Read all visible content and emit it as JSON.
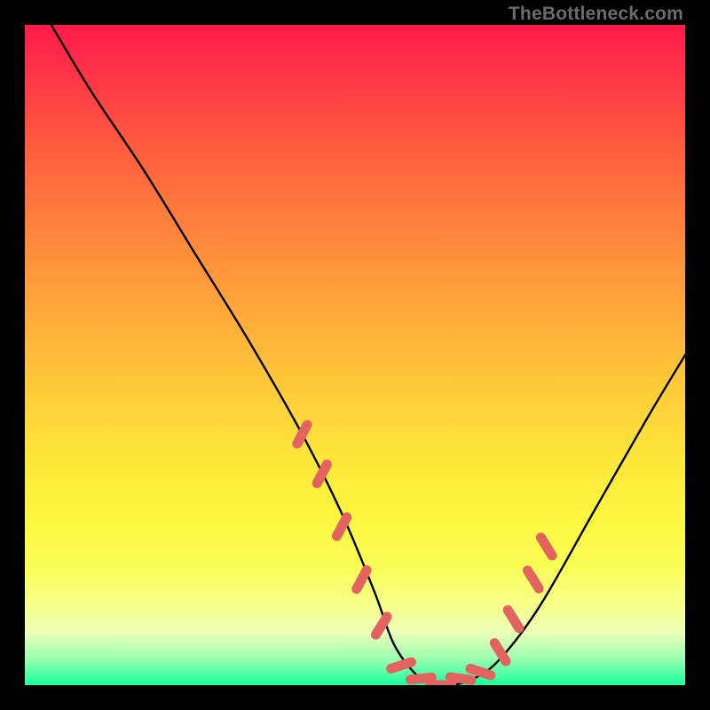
{
  "watermark": "TheBottleneck.com",
  "chart_data": {
    "type": "line",
    "title": "",
    "xlabel": "",
    "ylabel": "",
    "xlim": [
      0,
      100
    ],
    "ylim": [
      0,
      100
    ],
    "background_gradient": {
      "direction": "vertical",
      "stops": [
        {
          "pos": 0,
          "color": "#ff1a4a"
        },
        {
          "pos": 50,
          "color": "#ffd339"
        },
        {
          "pos": 82,
          "color": "#faff55"
        },
        {
          "pos": 100,
          "color": "#19ff9e"
        }
      ]
    },
    "series": [
      {
        "name": "bottleneck-curve",
        "color": "#000000",
        "x": [
          4,
          10,
          18,
          26,
          34,
          42,
          48,
          53,
          56,
          60,
          64,
          68,
          72,
          78,
          86,
          94,
          100
        ],
        "values": [
          100,
          90,
          78,
          65,
          52,
          38,
          26,
          14,
          6,
          1,
          0,
          1,
          4,
          12,
          26,
          40,
          50
        ]
      }
    ],
    "markers": {
      "name": "highlight-dashes",
      "color": "#e2635f",
      "segments": [
        {
          "x": 42,
          "y": 38,
          "angle": -62
        },
        {
          "x": 45,
          "y": 32,
          "angle": -62
        },
        {
          "x": 48,
          "y": 24,
          "angle": -62
        },
        {
          "x": 51,
          "y": 16,
          "angle": -62
        },
        {
          "x": 54,
          "y": 9,
          "angle": -58
        },
        {
          "x": 57,
          "y": 3,
          "angle": -18
        },
        {
          "x": 60,
          "y": 1,
          "angle": -6
        },
        {
          "x": 63,
          "y": 0,
          "angle": 0
        },
        {
          "x": 66,
          "y": 1,
          "angle": 8
        },
        {
          "x": 69,
          "y": 2,
          "angle": 18
        },
        {
          "x": 72,
          "y": 5,
          "angle": 58
        },
        {
          "x": 74,
          "y": 10,
          "angle": 58
        },
        {
          "x": 77,
          "y": 16,
          "angle": 58
        },
        {
          "x": 79,
          "y": 21,
          "angle": 58
        }
      ]
    }
  }
}
